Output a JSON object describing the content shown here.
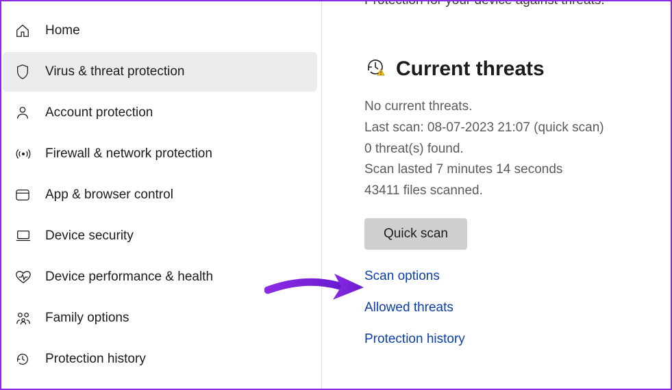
{
  "sidebar": {
    "items": [
      {
        "label": "Home",
        "key": "home"
      },
      {
        "label": "Virus & threat protection",
        "key": "virus",
        "selected": true
      },
      {
        "label": "Account protection",
        "key": "account"
      },
      {
        "label": "Firewall & network protection",
        "key": "firewall"
      },
      {
        "label": "App & browser control",
        "key": "appbrowser"
      },
      {
        "label": "Device security",
        "key": "devsec"
      },
      {
        "label": "Device performance & health",
        "key": "perf"
      },
      {
        "label": "Family options",
        "key": "family"
      },
      {
        "label": "Protection history",
        "key": "history"
      }
    ]
  },
  "main": {
    "cutoff_subtitle": "Protection for your device against threats.",
    "current_threats": {
      "title": "Current threats",
      "no_threats": "No current threats.",
      "last_scan": "Last scan: 08-07-2023 21:07 (quick scan)",
      "threats_found": "0 threat(s) found.",
      "scan_duration": "Scan lasted 7 minutes 14 seconds",
      "files_scanned": "43411 files scanned.",
      "quick_scan_button": "Quick scan",
      "links": {
        "scan_options": "Scan options",
        "allowed_threats": "Allowed threats",
        "protection_history": "Protection history"
      }
    }
  }
}
